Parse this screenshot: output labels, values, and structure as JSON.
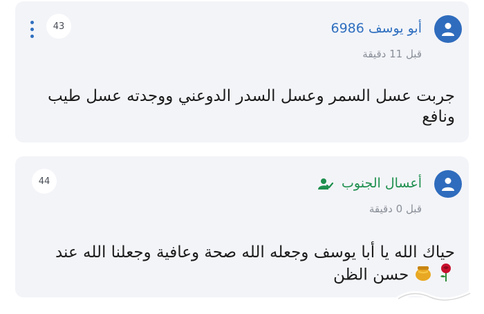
{
  "comments": [
    {
      "author": "أبو يوسف 6986",
      "time": "قبل 11 دقيقة",
      "number": "43",
      "text": "جربت عسل السمر وعسل السدر الدوعني ووجدته عسل طيب ونافع",
      "author_color": "#2f6fbf"
    },
    {
      "author": "أعسال الجنوب",
      "time": "قبل 0 دقيقة",
      "number": "44",
      "text": "حياك الله يا أبا يوسف وجعله الله صحة وعافية وجعلنا الله عند حسن الظن",
      "author_color": "#1e8f4e",
      "verified": true,
      "emojis": [
        "honey-pot",
        "rose"
      ]
    }
  ],
  "watermark": "حراج"
}
